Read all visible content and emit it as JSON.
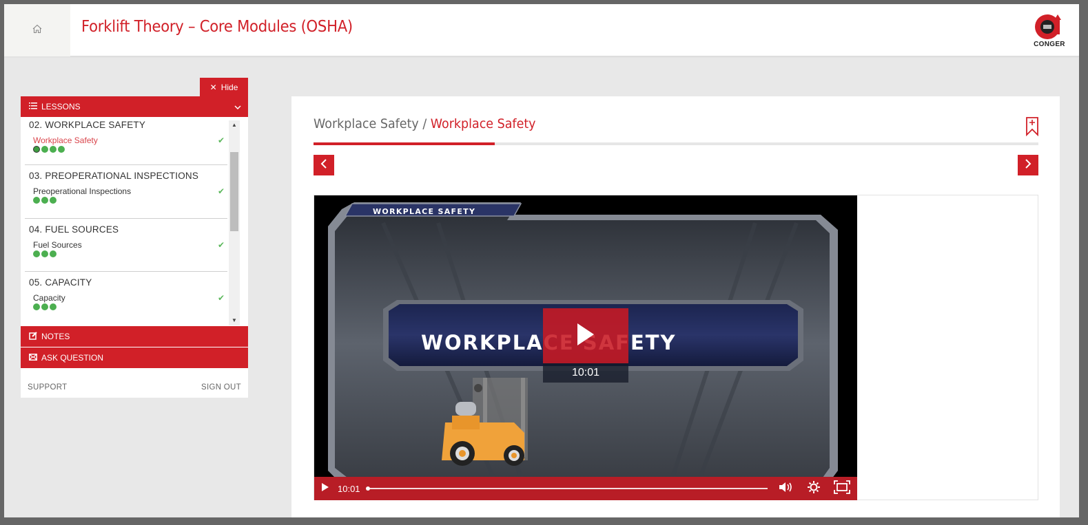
{
  "header": {
    "home_icon": "home-icon",
    "title": "Forklift Theory – Core Modules (OSHA)",
    "logo_text": "CONGER"
  },
  "sidebar": {
    "hide_label": "Hide",
    "lessons_label": "LESSONS",
    "groups": [
      {
        "title": "02. WORKPLACE SAFETY",
        "lesson": "Workplace Safety",
        "active": true,
        "completed": true,
        "dots": 4
      },
      {
        "title": "03. PREOPERATIONAL INSPECTIONS",
        "lesson": "Preoperational Inspections",
        "active": false,
        "completed": true,
        "dots": 3
      },
      {
        "title": "04. FUEL SOURCES",
        "lesson": "Fuel Sources",
        "active": false,
        "completed": true,
        "dots": 3
      },
      {
        "title": "05. CAPACITY",
        "lesson": "Capacity",
        "active": false,
        "completed": true,
        "dots": 3
      }
    ],
    "notes_label": "NOTES",
    "ask_label": "ASK QUESTION",
    "support_label": "SUPPORT",
    "signout_label": "SIGN OUT"
  },
  "main": {
    "breadcrumb_parent": "Workplace Safety",
    "breadcrumb_sep": " / ",
    "breadcrumb_current": "Workplace Safety",
    "progress_percent": 25,
    "video": {
      "slide_small_title": "WORKPLACE SAFETY",
      "slide_big_title": "WORKPLACE SAFETY",
      "duration_overlay": "10:01",
      "control_time": "10:01",
      "seek_percent": 0
    }
  },
  "colors": {
    "brand_red": "#d12028",
    "check_green": "#5cb85c",
    "dot_green": "#4caf50"
  }
}
